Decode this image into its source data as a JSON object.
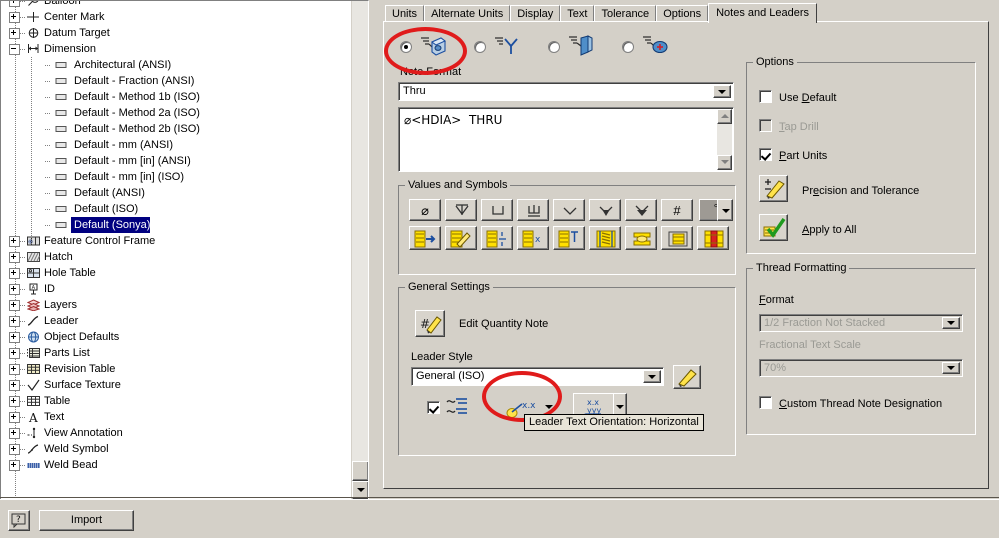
{
  "tree": {
    "items": [
      {
        "label": "Balloon",
        "icon": "balloon-icon",
        "level": 0,
        "expander": "plus",
        "selected": false
      },
      {
        "label": "Center Mark",
        "icon": "center-mark-icon",
        "level": 0,
        "expander": "plus",
        "selected": false
      },
      {
        "label": "Datum Target",
        "icon": "datum-target-icon",
        "level": 0,
        "expander": "plus",
        "selected": false
      },
      {
        "label": "Dimension",
        "icon": "dimension-icon",
        "level": 0,
        "expander": "minus",
        "selected": false
      },
      {
        "label": "Architectural (ANSI)",
        "icon": "style-icon",
        "level": 1,
        "expander": "none",
        "selected": false
      },
      {
        "label": "Default - Fraction (ANSI)",
        "icon": "style-icon",
        "level": 1,
        "expander": "none",
        "selected": false
      },
      {
        "label": "Default - Method 1b (ISO)",
        "icon": "style-icon",
        "level": 1,
        "expander": "none",
        "selected": false
      },
      {
        "label": "Default - Method 2a (ISO)",
        "icon": "style-icon",
        "level": 1,
        "expander": "none",
        "selected": false
      },
      {
        "label": "Default - Method 2b (ISO)",
        "icon": "style-icon",
        "level": 1,
        "expander": "none",
        "selected": false
      },
      {
        "label": "Default - mm (ANSI)",
        "icon": "style-icon",
        "level": 1,
        "expander": "none",
        "selected": false
      },
      {
        "label": "Default - mm [in] (ANSI)",
        "icon": "style-icon",
        "level": 1,
        "expander": "none",
        "selected": false
      },
      {
        "label": "Default - mm [in] (ISO)",
        "icon": "style-icon",
        "level": 1,
        "expander": "none",
        "selected": false
      },
      {
        "label": "Default (ANSI)",
        "icon": "style-icon",
        "level": 1,
        "expander": "none",
        "selected": false
      },
      {
        "label": "Default (ISO)",
        "icon": "style-icon",
        "level": 1,
        "expander": "none",
        "selected": false
      },
      {
        "label": "Default (Sonya)",
        "icon": "style-icon",
        "level": 1,
        "expander": "none",
        "selected": true
      },
      {
        "label": "Feature Control Frame",
        "icon": "feature-control-frame-icon",
        "level": 0,
        "expander": "plus",
        "selected": false
      },
      {
        "label": "Hatch",
        "icon": "hatch-icon",
        "level": 0,
        "expander": "plus",
        "selected": false
      },
      {
        "label": "Hole Table",
        "icon": "hole-table-icon",
        "level": 0,
        "expander": "plus",
        "selected": false
      },
      {
        "label": "ID",
        "icon": "id-icon",
        "level": 0,
        "expander": "plus",
        "selected": false
      },
      {
        "label": "Layers",
        "icon": "layers-icon",
        "level": 0,
        "expander": "plus",
        "selected": false
      },
      {
        "label": "Leader",
        "icon": "leader-icon",
        "level": 0,
        "expander": "plus",
        "selected": false
      },
      {
        "label": "Object Defaults",
        "icon": "object-defaults-icon",
        "level": 0,
        "expander": "plus",
        "selected": false
      },
      {
        "label": "Parts List",
        "icon": "parts-list-icon",
        "level": 0,
        "expander": "plus",
        "selected": false
      },
      {
        "label": "Revision Table",
        "icon": "revision-table-icon",
        "level": 0,
        "expander": "plus",
        "selected": false
      },
      {
        "label": "Surface Texture",
        "icon": "surface-texture-icon",
        "level": 0,
        "expander": "plus",
        "selected": false
      },
      {
        "label": "Table",
        "icon": "table-icon",
        "level": 0,
        "expander": "plus",
        "selected": false
      },
      {
        "label": "Text",
        "icon": "text-icon",
        "level": 0,
        "expander": "plus",
        "selected": false
      },
      {
        "label": "View Annotation",
        "icon": "view-annotation-icon",
        "level": 0,
        "expander": "plus",
        "selected": false
      },
      {
        "label": "Weld Symbol",
        "icon": "weld-symbol-icon",
        "level": 0,
        "expander": "plus",
        "selected": false
      },
      {
        "label": "Weld Bead",
        "icon": "weld-bead-icon",
        "level": 0,
        "expander": "plus",
        "selected": false
      }
    ]
  },
  "tabs": [
    {
      "label": "Units",
      "active": false
    },
    {
      "label": "Alternate Units",
      "active": false
    },
    {
      "label": "Display",
      "active": false
    },
    {
      "label": "Text",
      "active": false
    },
    {
      "label": "Tolerance",
      "active": false
    },
    {
      "label": "Options",
      "active": false
    },
    {
      "label": "Notes and Leaders",
      "active": true
    }
  ],
  "note_format": {
    "label": "Note Format",
    "radios": [
      {
        "name": "hole-note-radio",
        "checked": true,
        "icon": "hole-note-icon"
      },
      {
        "name": "chamfer-note-radio",
        "checked": false,
        "icon": "chamfer-note-icon"
      },
      {
        "name": "bend-note-radio",
        "checked": false,
        "icon": "bend-note-icon"
      },
      {
        "name": "punch-note-radio",
        "checked": false,
        "icon": "punch-note-icon"
      }
    ],
    "combo_value": "Thru",
    "note_text": "⌀<HDIA>  THRU"
  },
  "values_and_symbols": {
    "title": "Values and Symbols",
    "row1": [
      {
        "name": "diameter-symbol-button",
        "glyph": "⌀"
      },
      {
        "name": "depth-symbol-button",
        "glyph": "depth"
      },
      {
        "name": "counterbore-symbol-button",
        "glyph": "counterbore"
      },
      {
        "name": "spotface-symbol-button",
        "glyph": "spotface"
      },
      {
        "name": "countersink-symbol-button",
        "glyph": "countersink"
      },
      {
        "name": "conical-taper-symbol-button",
        "glyph": "conical"
      },
      {
        "name": "deep-symbol-button",
        "glyph": "deep"
      },
      {
        "name": "number-symbol-button",
        "glyph": "#"
      }
    ],
    "symbol_dropdown": {
      "name": "more-symbols-dropdown",
      "value": "°"
    },
    "row2": [
      {
        "name": "insert-value-button"
      },
      {
        "name": "edit-value-button"
      },
      {
        "name": "stacked-value-button"
      },
      {
        "name": "quantity-value-button"
      },
      {
        "name": "insert-text-button"
      },
      {
        "name": "hole-thread-button"
      },
      {
        "name": "thread-note-button"
      },
      {
        "name": "hole-tag-button"
      },
      {
        "name": "tapped-hole-button"
      }
    ]
  },
  "general_settings": {
    "title": "General Settings",
    "edit_quantity_note": {
      "label": "Edit Quantity Note",
      "icon": "quantity-note-icon"
    },
    "leader_style_label": "Leader Style",
    "leader_style_value": "General (ISO)",
    "edit_leader_style": {
      "name": "edit-leader-style-button",
      "icon": "pencil-icon"
    },
    "wrap_checkbox": {
      "checked": true,
      "name": "leader-text-wrap-checkbox",
      "icon": "text-wrap-icon"
    },
    "leader_orientation": {
      "name": "leader-text-orientation-button",
      "icon": "leader-orientation-icon",
      "label": "x.x"
    },
    "leader_justification": {
      "name": "leader-text-justification-button",
      "icon": "leader-justification-icon",
      "label": "x.x / yyy"
    }
  },
  "tooltip": {
    "text": "Leader Text Orientation: Horizontal"
  },
  "options_panel": {
    "title": "Options",
    "use_default": {
      "label": "Use Default",
      "checked": false,
      "disabled": false,
      "mnemonic": "D"
    },
    "tap_drill": {
      "label": "Tap Drill",
      "checked": false,
      "disabled": true,
      "mnemonic": "T"
    },
    "part_units": {
      "label": "Part Units",
      "checked": true,
      "disabled": false,
      "mnemonic": "P"
    },
    "precision_and_tolerance": {
      "label": "Precision and Tolerance",
      "icon": "precision-tolerance-icon"
    },
    "apply_to_all": {
      "label": "Apply to All",
      "icon": "apply-to-all-icon"
    }
  },
  "thread_formatting": {
    "title": "Thread Formatting",
    "format_label": "Format",
    "format_value": "1/2 Fraction Not Stacked",
    "fractional_text_scale_label": "Fractional Text Scale",
    "fractional_text_scale_value": "70%",
    "custom_thread_note": {
      "label": "Custom Thread Note Designation",
      "checked": false
    }
  },
  "bottom_bar": {
    "help_button": {
      "name": "help-button",
      "glyph": "?"
    },
    "import_button": {
      "label": "Import"
    }
  },
  "colors": {
    "window_face": "#d4d0c8",
    "selection_blue": "#000080",
    "annotation_red": "#e01b1b",
    "tooltip_bg": "#e8e4d8",
    "symbol_yellow": "#ffe000",
    "icon_blue": "#1c4fa0"
  }
}
